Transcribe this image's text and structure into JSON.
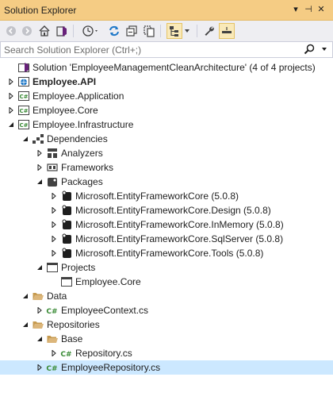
{
  "window": {
    "title": "Solution Explorer",
    "controls": {
      "dropdown": "▾",
      "pin": "⊣",
      "close": "✕"
    }
  },
  "search": {
    "placeholder": "Search Solution Explorer (Ctrl+;)"
  },
  "colors": {
    "title_bar": "#f5cc84",
    "toolbar": "#eeeef2",
    "selected_row": "#cce8ff",
    "csharp_green": "#388a34",
    "folder_yellow": "#dcb67a",
    "refresh_blue": "#1e78c8"
  },
  "tree": [
    {
      "label": "Solution 'EmployeeManagementCleanArchitecture' (4 of 4 projects)",
      "icon": "solution-icon",
      "depth": 0,
      "expander": "none"
    },
    {
      "label": "Employee.API",
      "icon": "web-project-icon",
      "depth": 0,
      "expander": "collapsed",
      "bold": true
    },
    {
      "label": "Employee.Application",
      "icon": "csharp-project-icon",
      "depth": 0,
      "expander": "collapsed"
    },
    {
      "label": "Employee.Core",
      "icon": "csharp-project-icon",
      "depth": 0,
      "expander": "collapsed"
    },
    {
      "label": "Employee.Infrastructure",
      "icon": "csharp-project-icon",
      "depth": 0,
      "expander": "expanded"
    },
    {
      "label": "Dependencies",
      "icon": "dependencies-icon",
      "depth": 1,
      "expander": "expanded"
    },
    {
      "label": "Analyzers",
      "icon": "analyzers-icon",
      "depth": 2,
      "expander": "collapsed"
    },
    {
      "label": "Frameworks",
      "icon": "frameworks-icon",
      "depth": 2,
      "expander": "collapsed"
    },
    {
      "label": "Packages",
      "icon": "packages-icon",
      "depth": 2,
      "expander": "expanded"
    },
    {
      "label": "Microsoft.EntityFrameworkCore (5.0.8)",
      "icon": "package-icon",
      "depth": 3,
      "expander": "collapsed"
    },
    {
      "label": "Microsoft.EntityFrameworkCore.Design (5.0.8)",
      "icon": "package-icon",
      "depth": 3,
      "expander": "collapsed"
    },
    {
      "label": "Microsoft.EntityFrameworkCore.InMemory (5.0.8)",
      "icon": "package-icon",
      "depth": 3,
      "expander": "collapsed"
    },
    {
      "label": "Microsoft.EntityFrameworkCore.SqlServer (5.0.8)",
      "icon": "package-icon",
      "depth": 3,
      "expander": "collapsed"
    },
    {
      "label": "Microsoft.EntityFrameworkCore.Tools (5.0.8)",
      "icon": "package-icon",
      "depth": 3,
      "expander": "collapsed"
    },
    {
      "label": "Projects",
      "icon": "projects-icon",
      "depth": 2,
      "expander": "expanded"
    },
    {
      "label": "Employee.Core",
      "icon": "project-reference-icon",
      "depth": 3,
      "expander": "none"
    },
    {
      "label": "Data",
      "icon": "folder-open-icon",
      "depth": 1,
      "expander": "expanded"
    },
    {
      "label": "EmployeeContext.cs",
      "icon": "csharp-file-icon",
      "depth": 2,
      "expander": "collapsed"
    },
    {
      "label": "Repositories",
      "icon": "folder-open-icon",
      "depth": 1,
      "expander": "expanded"
    },
    {
      "label": "Base",
      "icon": "folder-open-icon",
      "depth": 2,
      "expander": "expanded"
    },
    {
      "label": "Repository.cs",
      "icon": "csharp-file-icon",
      "depth": 3,
      "expander": "collapsed"
    },
    {
      "label": "EmployeeRepository.cs",
      "icon": "csharp-file-icon",
      "depth": 2,
      "expander": "collapsed",
      "selected": true
    }
  ]
}
